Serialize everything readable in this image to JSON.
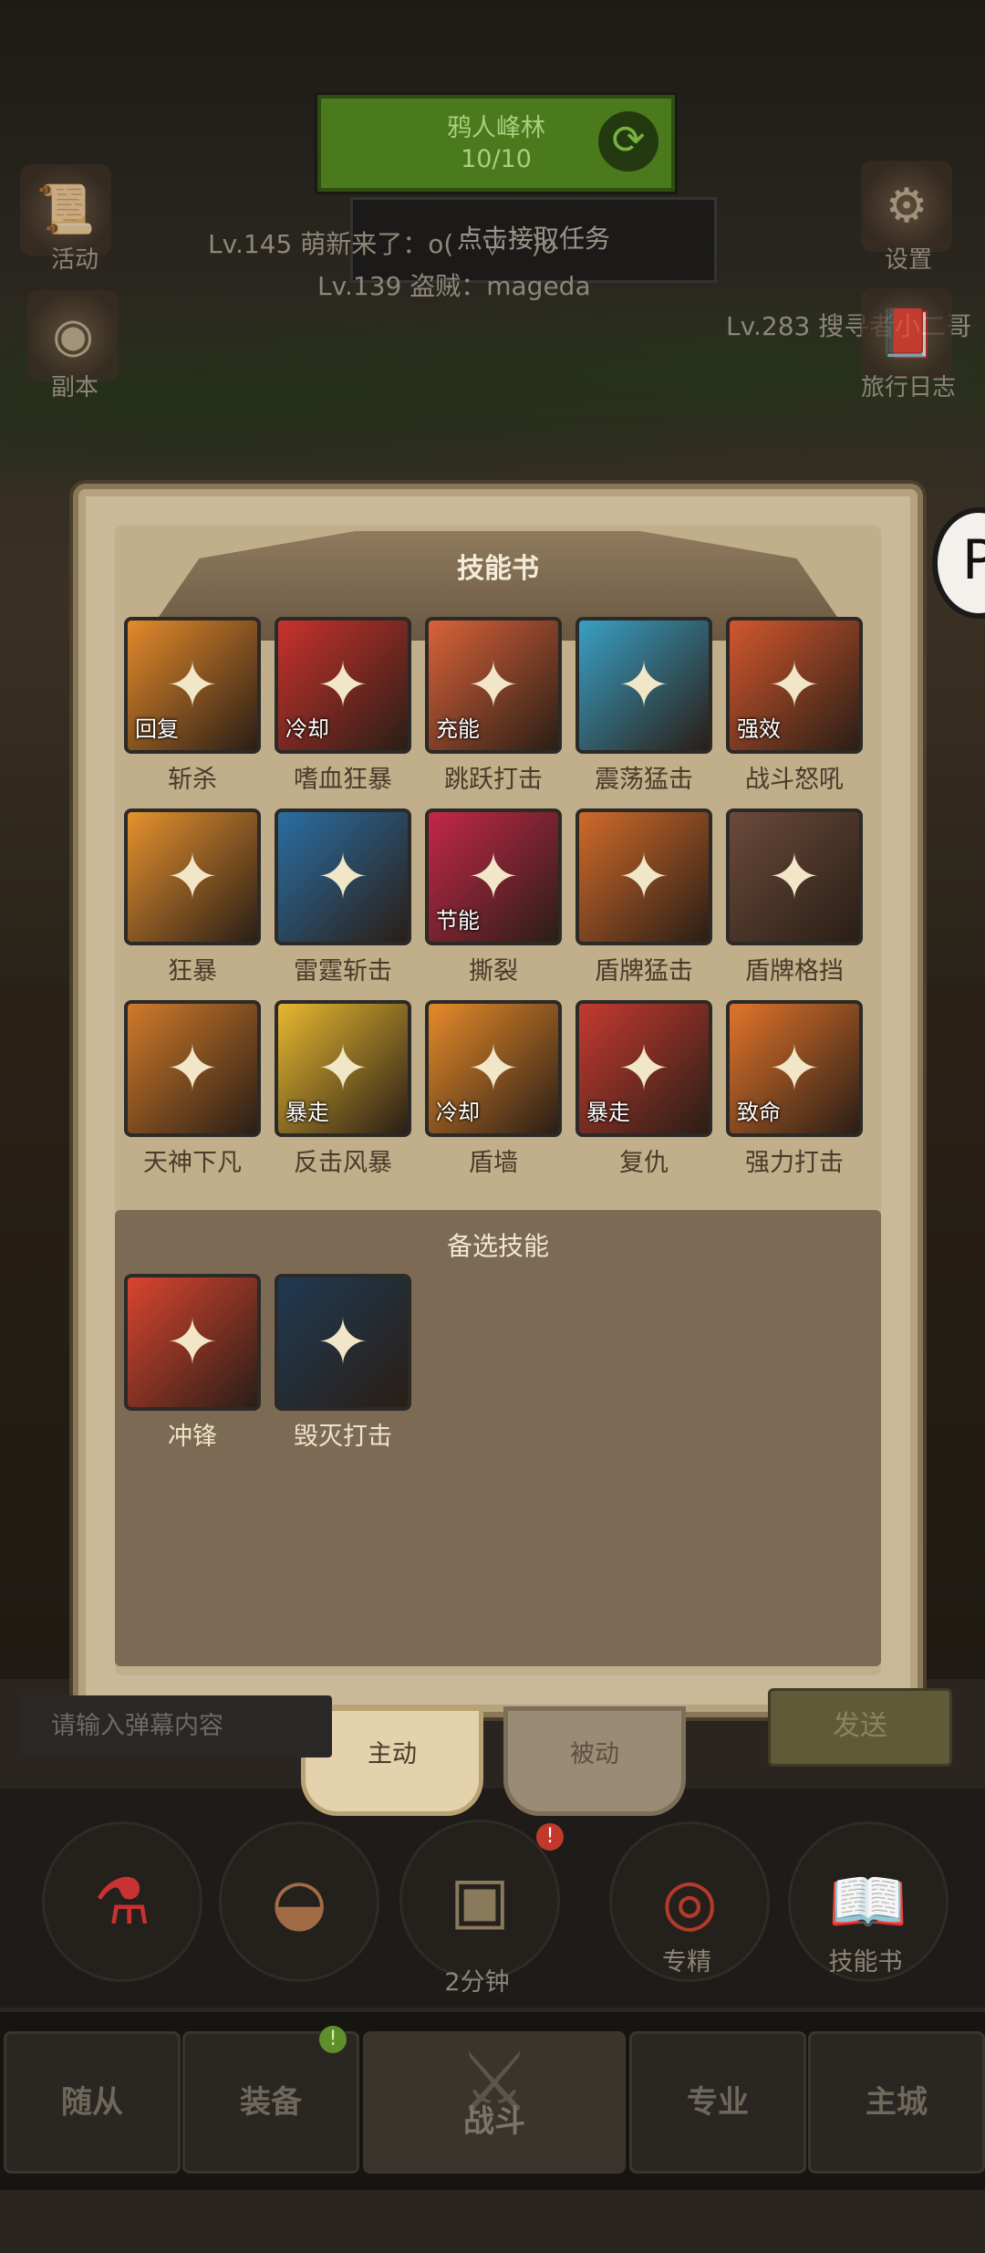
{
  "hud": {
    "quest_title": "鸦人峰林",
    "quest_progress": "10/10",
    "accept_task": "点击接取任务",
    "feed": [
      "Lv.145 萌新来了：o( ´ ▽ ` )o",
      "Lv.139 盗贼：mageda",
      "Lv.283 搜寻者小二哥"
    ],
    "left_icons": [
      {
        "label": "活动",
        "icon": "scroll-icon"
      },
      {
        "label": "副本",
        "icon": "portal-icon"
      }
    ],
    "right_icons": [
      {
        "label": "设置",
        "icon": "gear-icon"
      },
      {
        "label": "旅行日志",
        "icon": "journal-icon"
      }
    ]
  },
  "panel": {
    "title": "技能书",
    "skills": [
      {
        "name": "斩杀",
        "tag": "回复",
        "color": "#e38a2b"
      },
      {
        "name": "嗜血狂暴",
        "tag": "冷却",
        "color": "#c8322d"
      },
      {
        "name": "跳跃打击",
        "tag": "充能",
        "color": "#d9623a"
      },
      {
        "name": "震荡猛击",
        "tag": "",
        "color": "#3a9fc4"
      },
      {
        "name": "战斗怒吼",
        "tag": "强效",
        "color": "#d1572e"
      },
      {
        "name": "狂暴",
        "tag": "",
        "color": "#e6912f"
      },
      {
        "name": "雷霆斩击",
        "tag": "",
        "color": "#2a6ea3"
      },
      {
        "name": "撕裂",
        "tag": "节能",
        "color": "#c32848"
      },
      {
        "name": "盾牌猛击",
        "tag": "",
        "color": "#d06a2a"
      },
      {
        "name": "盾牌格挡",
        "tag": "",
        "color": "#6a4a3a"
      },
      {
        "name": "天神下凡",
        "tag": "",
        "color": "#d07a2a"
      },
      {
        "name": "反击风暴",
        "tag": "暴走",
        "color": "#e6b830"
      },
      {
        "name": "盾墙",
        "tag": "冷却",
        "color": "#e68a2a"
      },
      {
        "name": "复仇",
        "tag": "暴走",
        "color": "#c43a30"
      },
      {
        "name": "强力打击",
        "tag": "致命",
        "color": "#e1742b"
      }
    ],
    "alt_title": "备选技能",
    "alt_skills": [
      {
        "name": "冲锋",
        "tag": "",
        "color": "#d9452f"
      },
      {
        "name": "毁灭打击",
        "tag": "",
        "color": "#1f3a52"
      }
    ]
  },
  "tabs": {
    "active": "主动",
    "passive": "被动"
  },
  "chat": {
    "placeholder": "请输入弹幕内容",
    "send": "发送"
  },
  "quick": [
    {
      "label": "",
      "icon": "potion-icon"
    },
    {
      "label": "",
      "icon": "bread-icon"
    },
    {
      "label": "2分钟",
      "icon": "chest-icon"
    },
    {
      "label": "专精",
      "icon": "target-icon"
    },
    {
      "label": "技能书",
      "icon": "book-icon"
    }
  ],
  "nav": [
    "随从",
    "装备",
    "战斗",
    "专业",
    "主城"
  ]
}
